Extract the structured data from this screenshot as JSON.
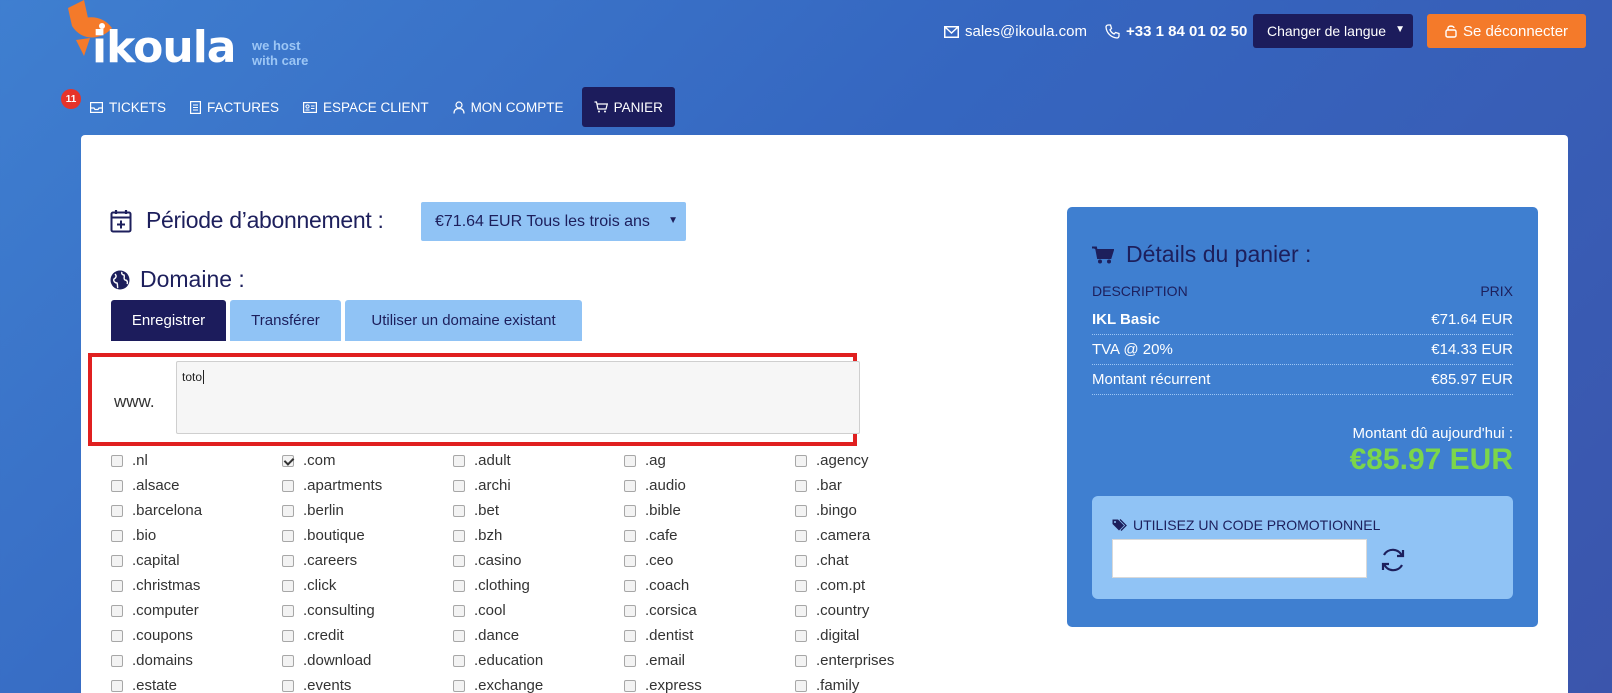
{
  "brand": {
    "name": "ikoula",
    "tagline": "we host\nwith care",
    "colors": {
      "navy": "#1c1c5c",
      "orange": "#f47a2a",
      "lightblue": "#90c3f5",
      "green": "#7cd64a",
      "red": "#e02020"
    }
  },
  "header": {
    "email": "sales@ikoula.com",
    "phone": "+33 1 84 01 02 50",
    "language_button": "Changer de langue",
    "logout_button": "Se déconnecter"
  },
  "nav": {
    "tickets": "TICKETS",
    "tickets_badge": "11",
    "factures": "FACTURES",
    "espace_client": "ESPACE CLIENT",
    "mon_compte": "MON COMPTE",
    "panier": "PANIER"
  },
  "period": {
    "title": "Période d’abonnement :",
    "selected": "€71.64 EUR Tous les trois ans"
  },
  "domain": {
    "title": "Domaine :",
    "tabs": [
      "Enregistrer",
      "Transférer",
      "Utiliser un domaine existant"
    ],
    "www_label": "www.",
    "input_value": "toto"
  },
  "tlds": [
    {
      "label": ".nl",
      "checked": false
    },
    {
      "label": ".com",
      "checked": true
    },
    {
      "label": ".adult",
      "checked": false
    },
    {
      "label": ".ag",
      "checked": false
    },
    {
      "label": ".agency",
      "checked": false
    },
    {
      "label": ".alsace",
      "checked": false
    },
    {
      "label": ".apartments",
      "checked": false
    },
    {
      "label": ".archi",
      "checked": false
    },
    {
      "label": ".audio",
      "checked": false
    },
    {
      "label": ".bar",
      "checked": false
    },
    {
      "label": ".barcelona",
      "checked": false
    },
    {
      "label": ".berlin",
      "checked": false
    },
    {
      "label": ".bet",
      "checked": false
    },
    {
      "label": ".bible",
      "checked": false
    },
    {
      "label": ".bingo",
      "checked": false
    },
    {
      "label": ".bio",
      "checked": false
    },
    {
      "label": ".boutique",
      "checked": false
    },
    {
      "label": ".bzh",
      "checked": false
    },
    {
      "label": ".cafe",
      "checked": false
    },
    {
      "label": ".camera",
      "checked": false
    },
    {
      "label": ".capital",
      "checked": false
    },
    {
      "label": ".careers",
      "checked": false
    },
    {
      "label": ".casino",
      "checked": false
    },
    {
      "label": ".ceo",
      "checked": false
    },
    {
      "label": ".chat",
      "checked": false
    },
    {
      "label": ".christmas",
      "checked": false
    },
    {
      "label": ".click",
      "checked": false
    },
    {
      "label": ".clothing",
      "checked": false
    },
    {
      "label": ".coach",
      "checked": false
    },
    {
      "label": ".com.pt",
      "checked": false
    },
    {
      "label": ".computer",
      "checked": false
    },
    {
      "label": ".consulting",
      "checked": false
    },
    {
      "label": ".cool",
      "checked": false
    },
    {
      "label": ".corsica",
      "checked": false
    },
    {
      "label": ".country",
      "checked": false
    },
    {
      "label": ".coupons",
      "checked": false
    },
    {
      "label": ".credit",
      "checked": false
    },
    {
      "label": ".dance",
      "checked": false
    },
    {
      "label": ".dentist",
      "checked": false
    },
    {
      "label": ".digital",
      "checked": false
    },
    {
      "label": ".domains",
      "checked": false
    },
    {
      "label": ".download",
      "checked": false
    },
    {
      "label": ".education",
      "checked": false
    },
    {
      "label": ".email",
      "checked": false
    },
    {
      "label": ".enterprises",
      "checked": false
    },
    {
      "label": ".estate",
      "checked": false
    },
    {
      "label": ".events",
      "checked": false
    },
    {
      "label": ".exchange",
      "checked": false
    },
    {
      "label": ".express",
      "checked": false
    },
    {
      "label": ".family",
      "checked": false
    }
  ],
  "cart": {
    "title": "Détails du panier :",
    "col_description": "DESCRIPTION",
    "col_price": "PRIX",
    "rows": [
      {
        "description": "IKL Basic",
        "price": "€71.64 EUR"
      },
      {
        "description": "TVA @ 20%",
        "price": "€14.33 EUR"
      },
      {
        "description": "Montant récurrent",
        "price": "€85.97 EUR"
      }
    ],
    "due_label": "Montant dû aujourd'hui :",
    "due_amount": "€85.97 EUR",
    "promo_title": "UTILISEZ UN CODE PROMOTIONNEL",
    "promo_value": ""
  }
}
